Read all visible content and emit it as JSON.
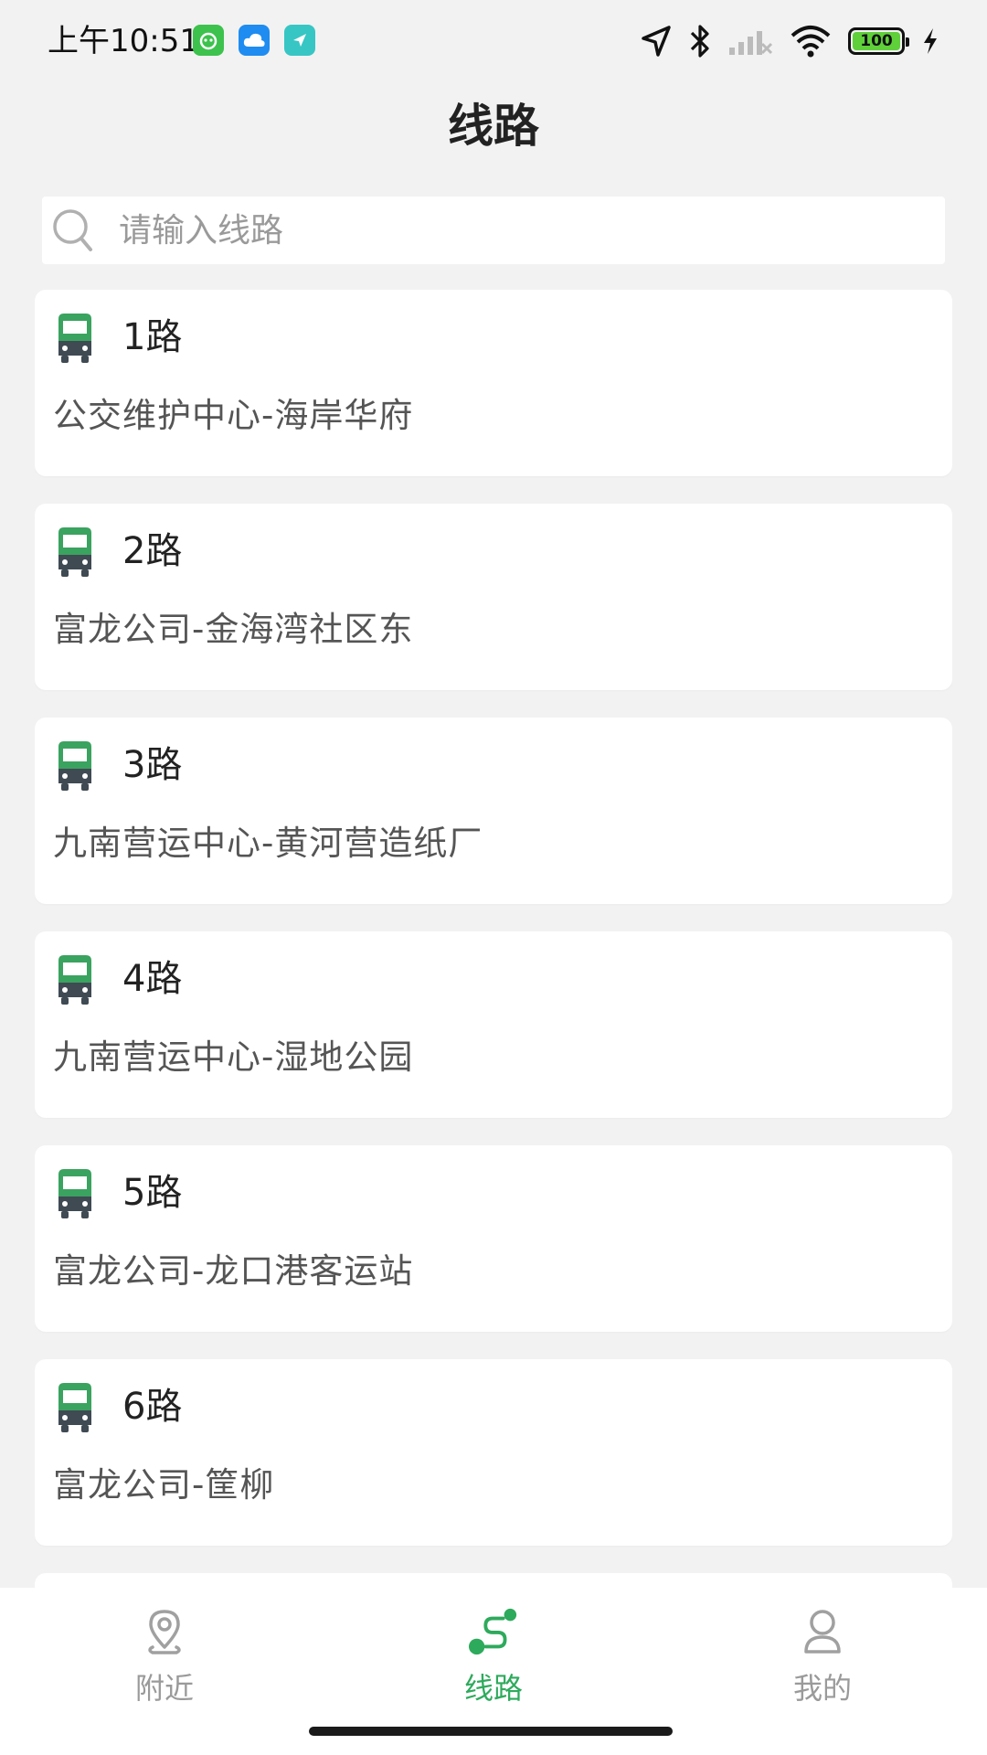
{
  "status_bar": {
    "time": "上午10:51",
    "battery": "100",
    "icons": [
      "app-green-icon",
      "cloud-icon",
      "navigation-app-icon",
      "location-arrow-icon",
      "bluetooth-icon",
      "signal-icon",
      "wifi-icon",
      "battery-icon",
      "charging-icon"
    ]
  },
  "header": {
    "title": "线路"
  },
  "search": {
    "placeholder": "请输入线路",
    "value": ""
  },
  "routes": [
    {
      "name": "1路",
      "endpoints": "公交维护中心-海岸华府"
    },
    {
      "name": "2路",
      "endpoints": "富龙公司-金海湾社区东"
    },
    {
      "name": "3路",
      "endpoints": "九南营运中心-黄河营造纸厂"
    },
    {
      "name": "4路",
      "endpoints": "九南营运中心-湿地公园"
    },
    {
      "name": "5路",
      "endpoints": "富龙公司-龙口港客运站"
    },
    {
      "name": "6路",
      "endpoints": "富龙公司-筐柳"
    },
    {
      "name": "",
      "endpoints": ""
    }
  ],
  "bottom_nav": {
    "items": [
      {
        "label": "附近",
        "icon": "location-pin-icon",
        "active": false
      },
      {
        "label": "线路",
        "icon": "route-icon",
        "active": true
      },
      {
        "label": "我的",
        "icon": "user-icon",
        "active": false
      }
    ]
  },
  "colors": {
    "accent": "#2eaa5c",
    "bus_icon_top": "#3aa35f",
    "bus_icon_bottom": "#3f4a53",
    "background": "#f2f2f2"
  }
}
